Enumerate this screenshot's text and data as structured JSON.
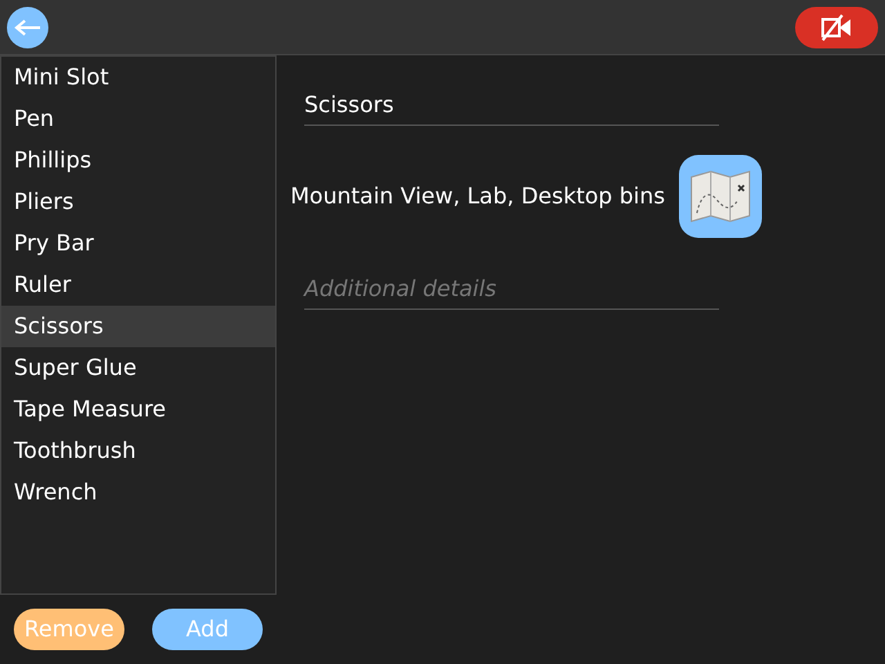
{
  "items": [
    {
      "label": "Mini Slot",
      "selected": false
    },
    {
      "label": "Pen",
      "selected": false
    },
    {
      "label": "Phillips",
      "selected": false
    },
    {
      "label": "Pliers",
      "selected": false
    },
    {
      "label": "Pry Bar",
      "selected": false
    },
    {
      "label": "Ruler",
      "selected": false
    },
    {
      "label": "Scissors",
      "selected": true
    },
    {
      "label": "Super Glue",
      "selected": false
    },
    {
      "label": "Tape Measure",
      "selected": false
    },
    {
      "label": "Toothbrush",
      "selected": false
    },
    {
      "label": "Wrench",
      "selected": false
    }
  ],
  "detail": {
    "name": "Scissors",
    "location": "Mountain View, Lab, Desktop bins",
    "details_placeholder": "Additional details"
  },
  "buttons": {
    "remove": "Remove",
    "add": "Add"
  }
}
